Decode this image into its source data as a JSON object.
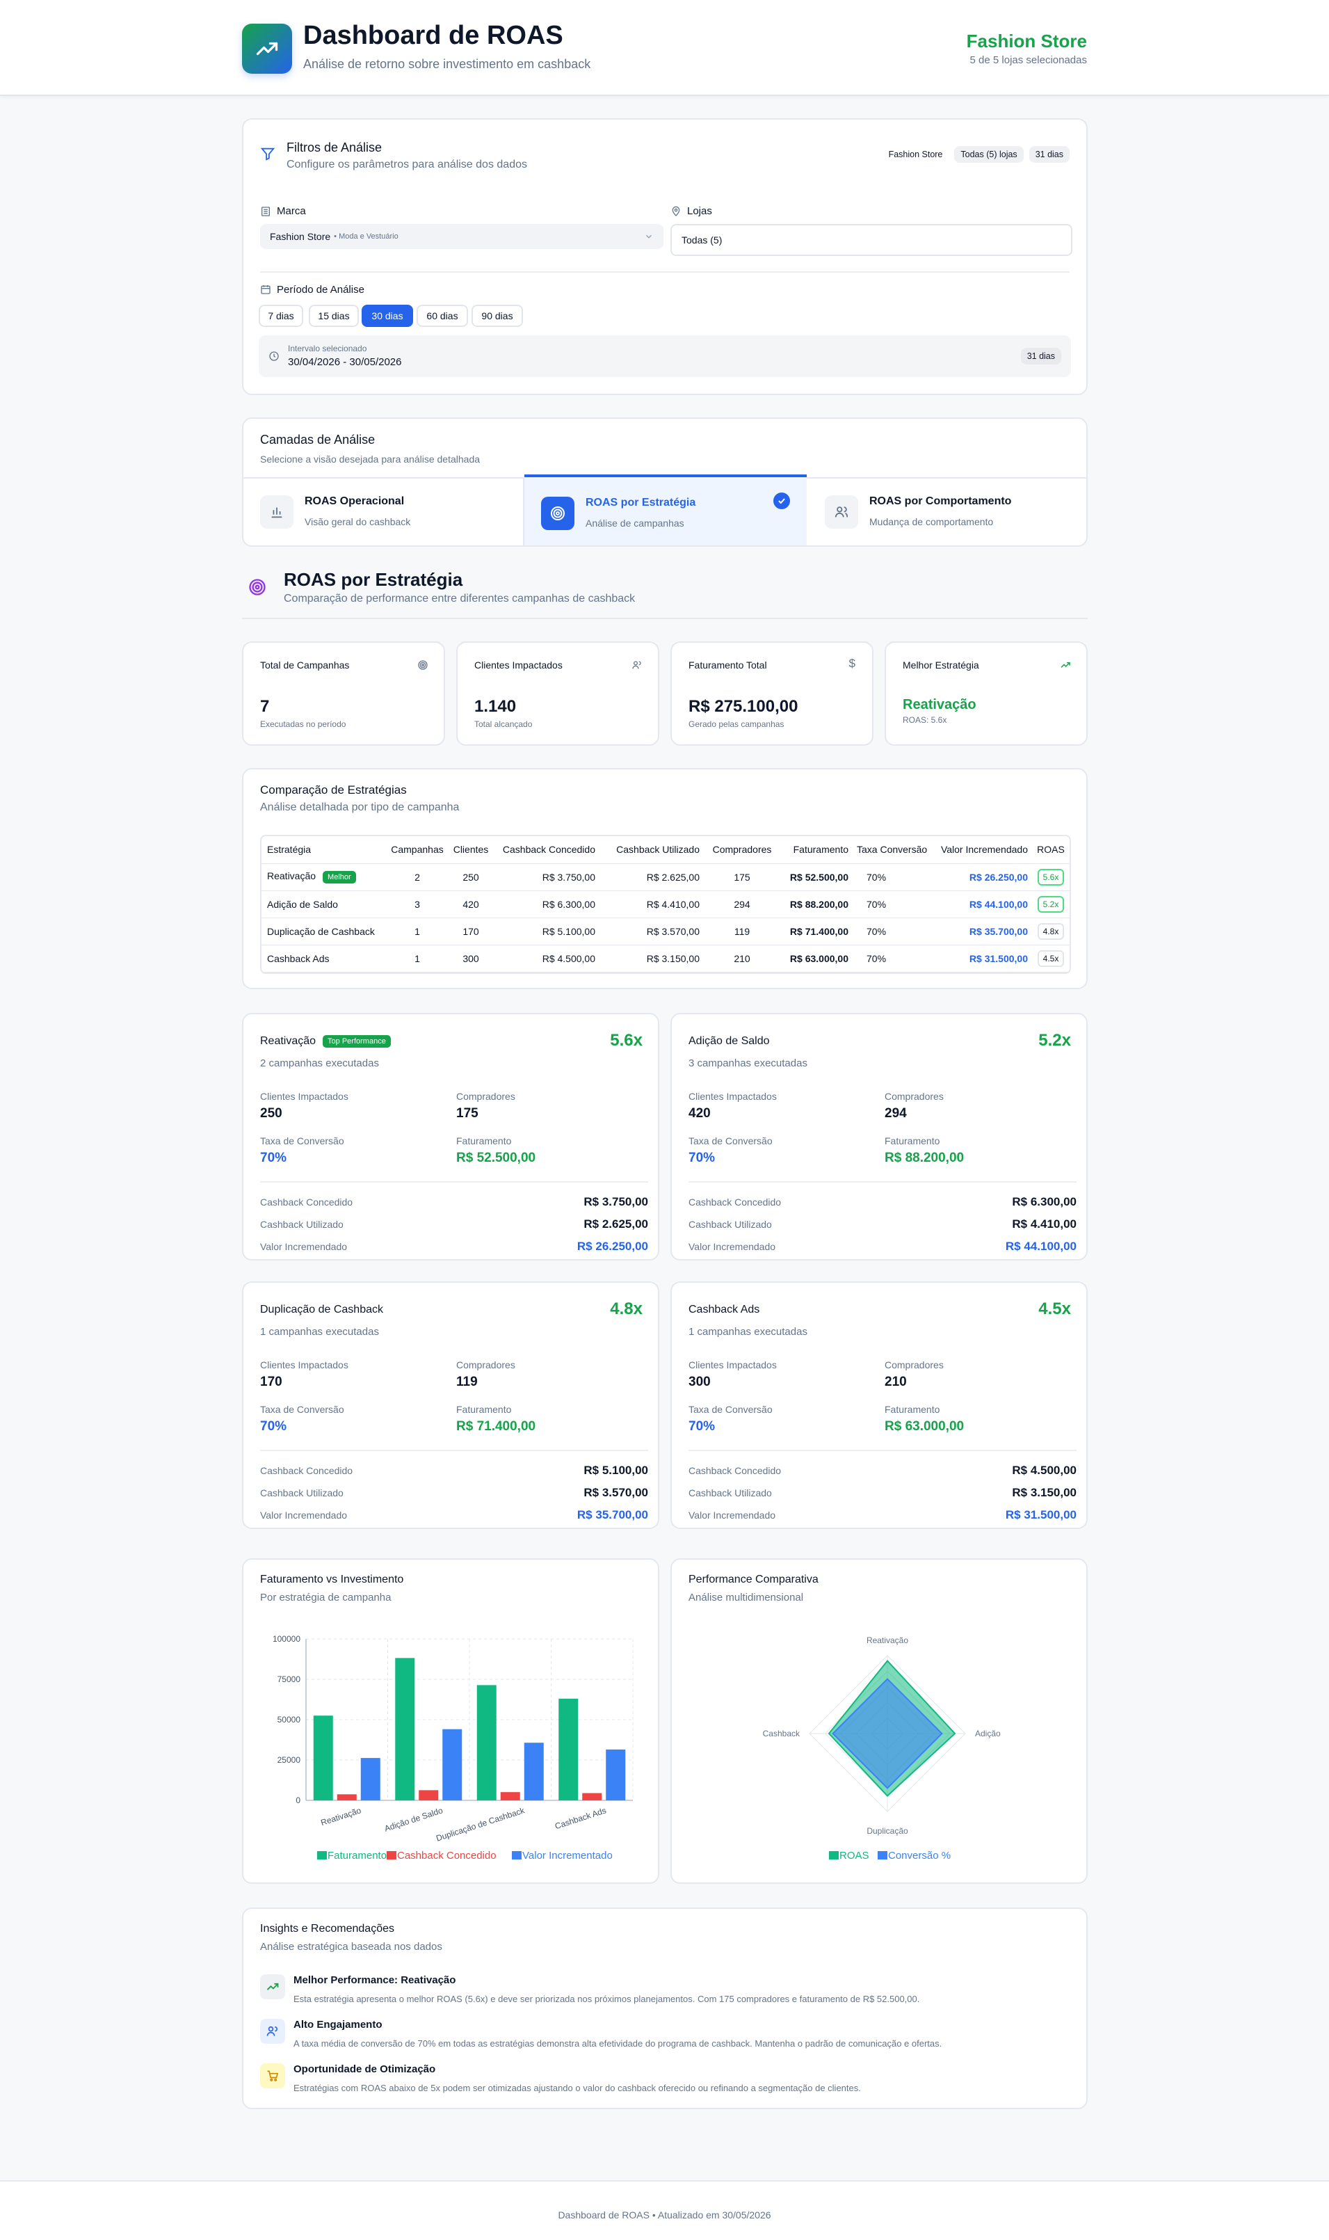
{
  "header": {
    "title": "Dashboard de ROAS",
    "subtitle": "Análise de retorno sobre investimento em cashback",
    "store_name": "Fashion Store",
    "store_sub": "5 de 5 lojas selecionadas"
  },
  "filters": {
    "title": "Filtros de Análise",
    "subtitle": "Configure os parâmetros para análise dos dados",
    "tags": [
      "Fashion Store",
      "Todas (5) lojas",
      "31 dias"
    ],
    "brand_label": "Marca",
    "brand_value": "Fashion Store",
    "brand_note": "• Moda e Vestuário",
    "stores_label": "Lojas",
    "stores_value": "Todas (5)",
    "period_label": "Período de Análise",
    "periods": [
      "7 dias",
      "15 dias",
      "30 dias",
      "60 dias",
      "90 dias"
    ],
    "active_period": "30 dias",
    "interval_label": "Intervalo selecionado",
    "interval_value": "30/04/2026 - 30/05/2026",
    "interval_days": "31 dias"
  },
  "layers": {
    "title": "Camadas de Análise",
    "subtitle": "Selecione a visão desejada para análise detalhada",
    "items": [
      {
        "title": "ROAS Operacional",
        "sub": "Visão geral do cashback"
      },
      {
        "title": "ROAS por Estratégia",
        "sub": "Análise de campanhas"
      },
      {
        "title": "ROAS por Comportamento",
        "sub": "Mudança de comportamento"
      }
    ]
  },
  "section": {
    "title": "ROAS por Estratégia",
    "subtitle": "Comparação de performance entre diferentes campanhas de cashback"
  },
  "kpis": [
    {
      "label": "Total de Campanhas",
      "value": "7",
      "sub": "Executadas no período",
      "icon": "target-icon"
    },
    {
      "label": "Clientes Impactados",
      "value": "1.140",
      "sub": "Total alcançado",
      "icon": "users-icon"
    },
    {
      "label": "Faturamento Total",
      "value": "R$ 275.100,00",
      "sub": "Gerado pelas campanhas",
      "icon": "dollar-icon"
    },
    {
      "label": "Melhor Estratégia",
      "value": "Reativação",
      "sub": "ROAS: 5.6x",
      "icon": "trending-up-icon"
    }
  ],
  "comparison": {
    "title": "Comparação de Estratégias",
    "subtitle": "Análise detalhada por tipo de campanha",
    "headers": [
      "Estratégia",
      "Campanhas",
      "Clientes",
      "Cashback Concedido",
      "Cashback Utilizado",
      "Compradores",
      "Faturamento",
      "Taxa Conversão",
      "Valor Incremendado",
      "ROAS"
    ],
    "best_badge": "Melhor",
    "rows": [
      {
        "name": "Reativação",
        "campaigns": "2",
        "clients": "250",
        "granted": "R$ 3.750,00",
        "used": "R$ 2.625,00",
        "buyers": "175",
        "revenue": "R$ 52.500,00",
        "conv": "70%",
        "incr": "R$ 26.250,00",
        "roas": "5.6x"
      },
      {
        "name": "Adição de Saldo",
        "campaigns": "3",
        "clients": "420",
        "granted": "R$ 6.300,00",
        "used": "R$ 4.410,00",
        "buyers": "294",
        "revenue": "R$ 88.200,00",
        "conv": "70%",
        "incr": "R$ 44.100,00",
        "roas": "5.2x"
      },
      {
        "name": "Duplicação de Cashback",
        "campaigns": "1",
        "clients": "170",
        "granted": "R$ 5.100,00",
        "used": "R$ 3.570,00",
        "buyers": "119",
        "revenue": "R$ 71.400,00",
        "conv": "70%",
        "incr": "R$ 35.700,00",
        "roas": "4.8x"
      },
      {
        "name": "Cashback Ads",
        "campaigns": "1",
        "clients": "300",
        "granted": "R$ 4.500,00",
        "used": "R$ 3.150,00",
        "buyers": "210",
        "revenue": "R$ 63.000,00",
        "conv": "70%",
        "incr": "R$ 31.500,00",
        "roas": "4.5x"
      }
    ]
  },
  "strategy_cards": {
    "labels": {
      "clients": "Clientes Impactados",
      "buyers": "Compradores",
      "conv": "Taxa de Conversão",
      "revenue": "Faturamento",
      "granted": "Cashback Concedido",
      "used": "Cashback Utilizado",
      "incr": "Valor Incremendado",
      "top": "Top Performance"
    },
    "items": [
      {
        "name": "Reativação",
        "roas": "5.6x",
        "campaigns": "2 campanhas executadas",
        "clients": "250",
        "buyers": "175",
        "conv": "70%",
        "revenue": "R$ 52.500,00",
        "granted": "R$ 3.750,00",
        "used": "R$ 2.625,00",
        "incr": "R$ 26.250,00"
      },
      {
        "name": "Adição de Saldo",
        "roas": "5.2x",
        "campaigns": "3 campanhas executadas",
        "clients": "420",
        "buyers": "294",
        "conv": "70%",
        "revenue": "R$ 88.200,00",
        "granted": "R$ 6.300,00",
        "used": "R$ 4.410,00",
        "incr": "R$ 44.100,00"
      },
      {
        "name": "Duplicação de Cashback",
        "roas": "4.8x",
        "campaigns": "1 campanhas executadas",
        "clients": "170",
        "buyers": "119",
        "conv": "70%",
        "revenue": "R$ 71.400,00",
        "granted": "R$ 5.100,00",
        "used": "R$ 3.570,00",
        "incr": "R$ 35.700,00"
      },
      {
        "name": "Cashback Ads",
        "roas": "4.5x",
        "campaigns": "1 campanhas executadas",
        "clients": "300",
        "buyers": "210",
        "conv": "70%",
        "revenue": "R$ 63.000,00",
        "granted": "R$ 4.500,00",
        "used": "R$ 3.150,00",
        "incr": "R$ 31.500,00"
      }
    ]
  },
  "charts": {
    "bar_title": "Faturamento vs Investimento",
    "bar_subtitle": "Por estratégia de campanha",
    "radar_title": "Performance Comparativa",
    "radar_subtitle": "Análise multidimensional"
  },
  "chart_data": [
    {
      "type": "bar",
      "categories": [
        "Reativação",
        "Adição de Saldo",
        "Duplicação de Cashback",
        "Cashback Ads"
      ],
      "series": [
        {
          "name": "Faturamento",
          "color": "#10b981",
          "values": [
            52500,
            88200,
            71400,
            63000
          ]
        },
        {
          "name": "Cashback Concedido",
          "color": "#ef4444",
          "values": [
            3750,
            6300,
            5100,
            4500
          ]
        },
        {
          "name": "Valor Incrementado",
          "color": "#3b82f6",
          "values": [
            26250,
            44100,
            35700,
            31500
          ]
        }
      ],
      "yticks": [
        "0",
        "25000",
        "50000",
        "75000",
        "100000"
      ],
      "ylim": [
        0,
        100000
      ],
      "grid": true,
      "legend": "bottom"
    },
    {
      "type": "radar",
      "axes": [
        "Reativação",
        "Adição",
        "Duplicação",
        "Cashback"
      ],
      "series": [
        {
          "name": "ROAS",
          "color": "#10b981",
          "values": [
            5.6,
            5.2,
            4.8,
            4.5
          ]
        },
        {
          "name": "Conversão %",
          "color": "#3b82f6",
          "values": [
            70,
            70,
            70,
            70
          ]
        }
      ],
      "legend": "bottom"
    }
  ],
  "insights": {
    "title": "Insights e Recomendações",
    "subtitle": "Análise estratégica baseada nos dados",
    "items": [
      {
        "title": "Melhor Performance: Reativação",
        "text": "Esta estratégia apresenta o melhor ROAS (5.6x) e deve ser priorizada nos próximos planejamentos. Com 175 compradores e faturamento de R$ 52.500,00."
      },
      {
        "title": "Alto Engajamento",
        "text": "A taxa média de conversão de 70% em todas as estratégias demonstra alta efetividade do programa de cashback. Mantenha o padrão de comunicação e ofertas."
      },
      {
        "title": "Oportunidade de Otimização",
        "text": "Estratégias com ROAS abaixo de 5x podem ser otimizadas ajustando o valor do cashback oferecido ou refinando a segmentação de clientes."
      }
    ]
  },
  "footer": {
    "text": "Dashboard de ROAS • Atualizado em 30/05/2026"
  }
}
